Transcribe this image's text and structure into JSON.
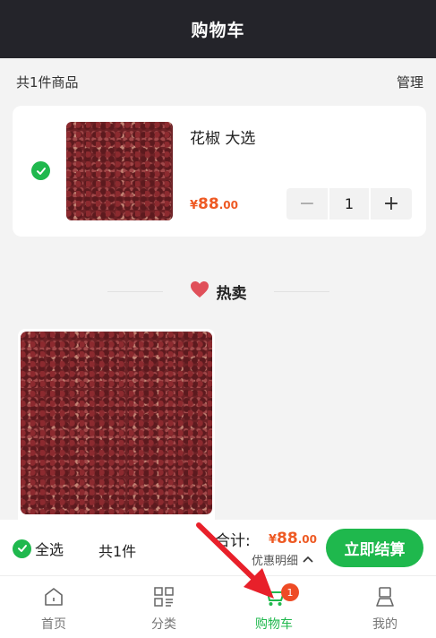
{
  "header": {
    "title": "购物车"
  },
  "meta": {
    "count_text": "共1件商品",
    "manage_label": "管理"
  },
  "cart_item": {
    "title": "花椒 大选",
    "price_symbol": "¥",
    "price_int": "88",
    "price_dec": ".00",
    "quantity": "1",
    "minus_label": "−",
    "plus_label": "+"
  },
  "hot": {
    "label": "热卖"
  },
  "bottom": {
    "select_all_label": "全选",
    "count_label": "共1件",
    "total_label": "合计:",
    "total_symbol": "¥",
    "total_int": "88",
    "total_dec": ".00",
    "discount_label": "优惠明细",
    "checkout_label": "立即结算"
  },
  "tabs": [
    {
      "label": "首页",
      "icon": "home-icon"
    },
    {
      "label": "分类",
      "icon": "grid-icon"
    },
    {
      "label": "购物车",
      "icon": "cart-icon",
      "badge": "1",
      "active": true
    },
    {
      "label": "我的",
      "icon": "profile-icon"
    }
  ],
  "colors": {
    "accent_green": "#1fb84d",
    "price_orange": "#ee5a24",
    "header_dark": "#24242a",
    "annotation_red": "#e8202a"
  }
}
